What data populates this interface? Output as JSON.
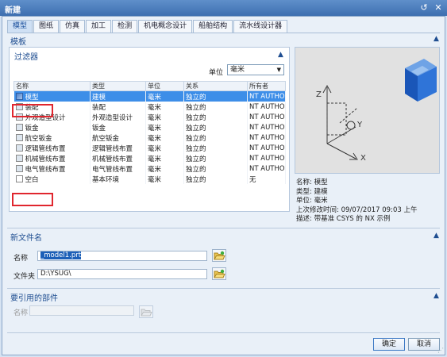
{
  "window": {
    "title": "新建",
    "restore_icon": "restore-icon",
    "close_icon": "close-icon"
  },
  "tabs": [
    "模型",
    "图纸",
    "仿真",
    "加工",
    "检测",
    "机电概念设计",
    "船舶结构",
    "流水线设计器"
  ],
  "template": {
    "section_title": "模板",
    "filter_title": "过滤器",
    "unit_label": "单位",
    "unit_value": "毫米",
    "columns": [
      "名称",
      "类型",
      "单位",
      "关系",
      "所有者"
    ],
    "rows": [
      [
        "模型",
        "建模",
        "毫米",
        "独立的",
        "NT AUTHO..."
      ],
      [
        "装配",
        "装配",
        "毫米",
        "独立的",
        "NT AUTHO..."
      ],
      [
        "外观造型设计",
        "外观造型设计",
        "毫米",
        "独立的",
        "NT AUTHO..."
      ],
      [
        "钣金",
        "钣金",
        "毫米",
        "独立的",
        "NT AUTHO..."
      ],
      [
        "航空钣金",
        "航空钣金",
        "毫米",
        "独立的",
        "NT AUTHO..."
      ],
      [
        "逻辑管线布置",
        "逻辑管线布置",
        "毫米",
        "独立的",
        "NT AUTHO..."
      ],
      [
        "机械管线布置",
        "机械管线布置",
        "毫米",
        "独立的",
        "NT AUTHO..."
      ],
      [
        "电气管线布置",
        "电气管线布置",
        "毫米",
        "独立的",
        "NT AUTHO..."
      ],
      [
        "空白",
        "基本环境",
        "毫米",
        "独立的",
        "无"
      ]
    ],
    "selected_row": 0
  },
  "preview": {
    "axis_x": "X",
    "axis_y": "Y",
    "axis_z": "Z"
  },
  "properties": {
    "name": "名称:  模型",
    "type": "类型:  建模",
    "unit": "单位:  毫米",
    "modified": "上次修改时间:  09/07/2017 09:03 上午",
    "desc": "描述:  带基准 CSYS 的 NX 示例"
  },
  "new_file": {
    "section_title": "新文件名",
    "name_label": "名称",
    "name_value": "_model1.prt",
    "folder_label": "文件夹",
    "folder_value": "D:\\YSUG\\"
  },
  "ref_part": {
    "section_title": "要引用的部件",
    "name_label": "名称",
    "name_value": ""
  },
  "buttons": {
    "ok": "确定",
    "cancel": "取消"
  }
}
